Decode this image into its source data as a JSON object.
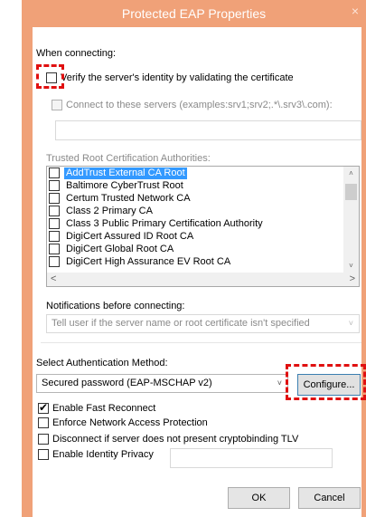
{
  "window": {
    "title": "Protected EAP Properties",
    "close_glyph": "×"
  },
  "connecting": {
    "heading": "When connecting:",
    "verify_label": "Verify the server's identity by validating the certificate",
    "verify_checked": false,
    "connect_label": "Connect to these servers (examples:srv1;srv2;.*\\.srv3\\.com):",
    "servers_value": ""
  },
  "trusted_ca": {
    "heading": "Trusted Root Certification Authorities:",
    "items": [
      {
        "label": "AddTrust External CA Root",
        "checked": false,
        "selected": true
      },
      {
        "label": "Baltimore CyberTrust Root",
        "checked": false,
        "selected": false
      },
      {
        "label": "Certum Trusted Network CA",
        "checked": false,
        "selected": false
      },
      {
        "label": "Class 2 Primary CA",
        "checked": false,
        "selected": false
      },
      {
        "label": "Class 3 Public Primary Certification Authority",
        "checked": false,
        "selected": false
      },
      {
        "label": "DigiCert Assured ID Root CA",
        "checked": false,
        "selected": false
      },
      {
        "label": "DigiCert Global Root CA",
        "checked": false,
        "selected": false
      },
      {
        "label": "DigiCert High Assurance EV Root CA",
        "checked": false,
        "selected": false
      }
    ],
    "scroll_up": "˄",
    "scroll_down": "˅",
    "scroll_left": "<",
    "scroll_right": ">"
  },
  "notifications": {
    "heading": "Notifications before connecting:",
    "selected": "Tell user if the server name or root certificate isn't specified",
    "arrow": "˅"
  },
  "auth": {
    "heading": "Select Authentication Method:",
    "selected": "Secured password (EAP-MSCHAP v2)",
    "arrow": "˅",
    "configure_label": "Configure..."
  },
  "options": [
    {
      "label": "Enable Fast Reconnect",
      "checked": true
    },
    {
      "label": "Enforce Network Access Protection",
      "checked": false
    },
    {
      "label": "Disconnect if server does not present cryptobinding TLV",
      "checked": false
    },
    {
      "label": "Enable Identity Privacy",
      "checked": false
    }
  ],
  "identity_value": "",
  "buttons": {
    "ok": "OK",
    "cancel": "Cancel"
  },
  "colors": {
    "titlebar": "#f0a178",
    "selection": "#3399ff",
    "highlight": "#e01010"
  }
}
